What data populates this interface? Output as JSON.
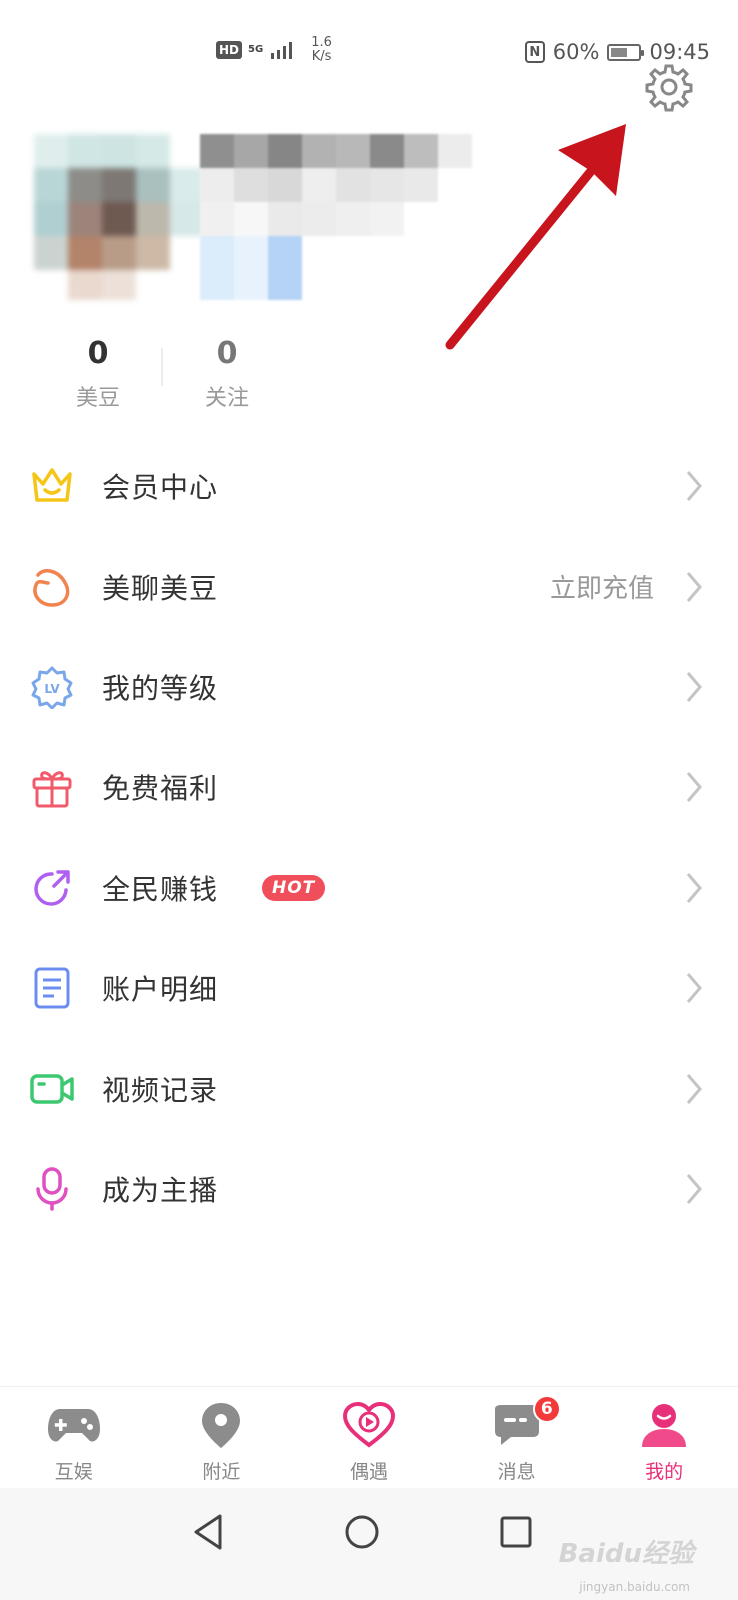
{
  "status_bar": {
    "hd": "HD",
    "network": "5G",
    "speed_value": "1.6",
    "speed_unit": "K/s",
    "nfc": "N",
    "battery_percent": "60%",
    "battery_level": 0.6,
    "time": "09:45"
  },
  "profile": {
    "stats": [
      {
        "value": "0",
        "label": "美豆"
      },
      {
        "value": "0",
        "label": "关注"
      }
    ]
  },
  "menu": {
    "items": [
      {
        "label": "会员中心",
        "icon": "crown-icon",
        "color": "#f5c518"
      },
      {
        "label": "美聊美豆",
        "icon": "bean-icon",
        "color": "#f0834e",
        "extra": "立即充值"
      },
      {
        "label": "我的等级",
        "icon": "level-badge-icon",
        "color": "#7aa6ea"
      },
      {
        "label": "免费福利",
        "icon": "gift-icon",
        "color": "#f05a6a"
      },
      {
        "label": "全民赚钱",
        "icon": "share-arrow-icon",
        "color": "#b060f0",
        "badge": "HOT"
      },
      {
        "label": "账户明细",
        "icon": "document-icon",
        "color": "#6b8cf0"
      },
      {
        "label": "视频记录",
        "icon": "video-camera-icon",
        "color": "#3cc870"
      },
      {
        "label": "成为主播",
        "icon": "microphone-icon",
        "color": "#e050c0"
      }
    ]
  },
  "bottom_nav": {
    "items": [
      {
        "label": "互娱",
        "icon": "gamepad-icon"
      },
      {
        "label": "附近",
        "icon": "location-pin-icon"
      },
      {
        "label": "偶遇",
        "icon": "heart-play-icon"
      },
      {
        "label": "消息",
        "icon": "chat-bubble-icon",
        "badge": "6"
      },
      {
        "label": "我的",
        "icon": "user-icon",
        "active": true
      }
    ],
    "active_color": "#e8307a"
  },
  "watermark": {
    "text": "Baidu经验",
    "sub": "jingyan.baidu.com"
  }
}
